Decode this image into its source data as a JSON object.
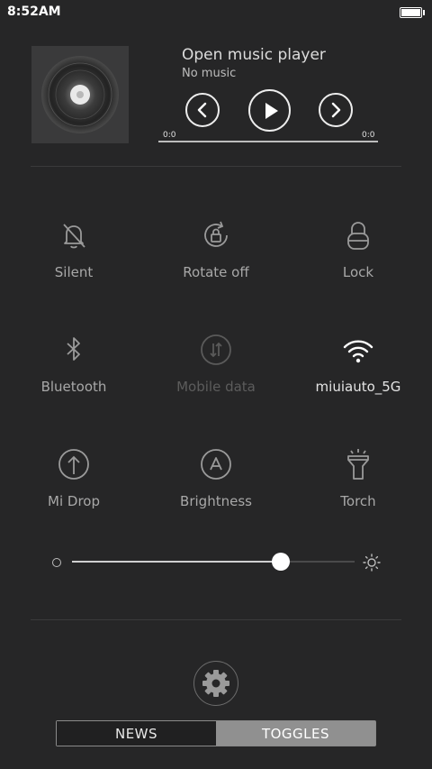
{
  "status_bar": {
    "time": "8:52AM"
  },
  "music": {
    "title": "Open music player",
    "subtitle": "No music",
    "time_start": "0:0",
    "time_end": "0:0",
    "progress": 0
  },
  "toggles": [
    {
      "label": "Silent",
      "icon": "bell-off-icon",
      "state": "off"
    },
    {
      "label": "Rotate off",
      "icon": "rotate-lock-icon",
      "state": "off"
    },
    {
      "label": "Lock",
      "icon": "lock-icon",
      "state": "off"
    },
    {
      "label": "Bluetooth",
      "icon": "bluetooth-icon",
      "state": "off"
    },
    {
      "label": "Mobile data",
      "icon": "mobile-data-icon",
      "state": "disabled"
    },
    {
      "label": "miuiauto_5G",
      "icon": "wifi-icon",
      "state": "on"
    },
    {
      "label": "Mi Drop",
      "icon": "upload-arrow-icon",
      "state": "off"
    },
    {
      "label": "Brightness",
      "icon": "auto-brightness-icon",
      "state": "off"
    },
    {
      "label": "Torch",
      "icon": "torch-icon",
      "state": "off"
    }
  ],
  "brightness": {
    "level": 0.74
  },
  "tabs": {
    "news": "NEWS",
    "toggles": "TOGGLES",
    "selected": "toggles"
  },
  "colors": {
    "background": "#262627",
    "selected_tab": "#909090",
    "accent": "#ffffff"
  }
}
